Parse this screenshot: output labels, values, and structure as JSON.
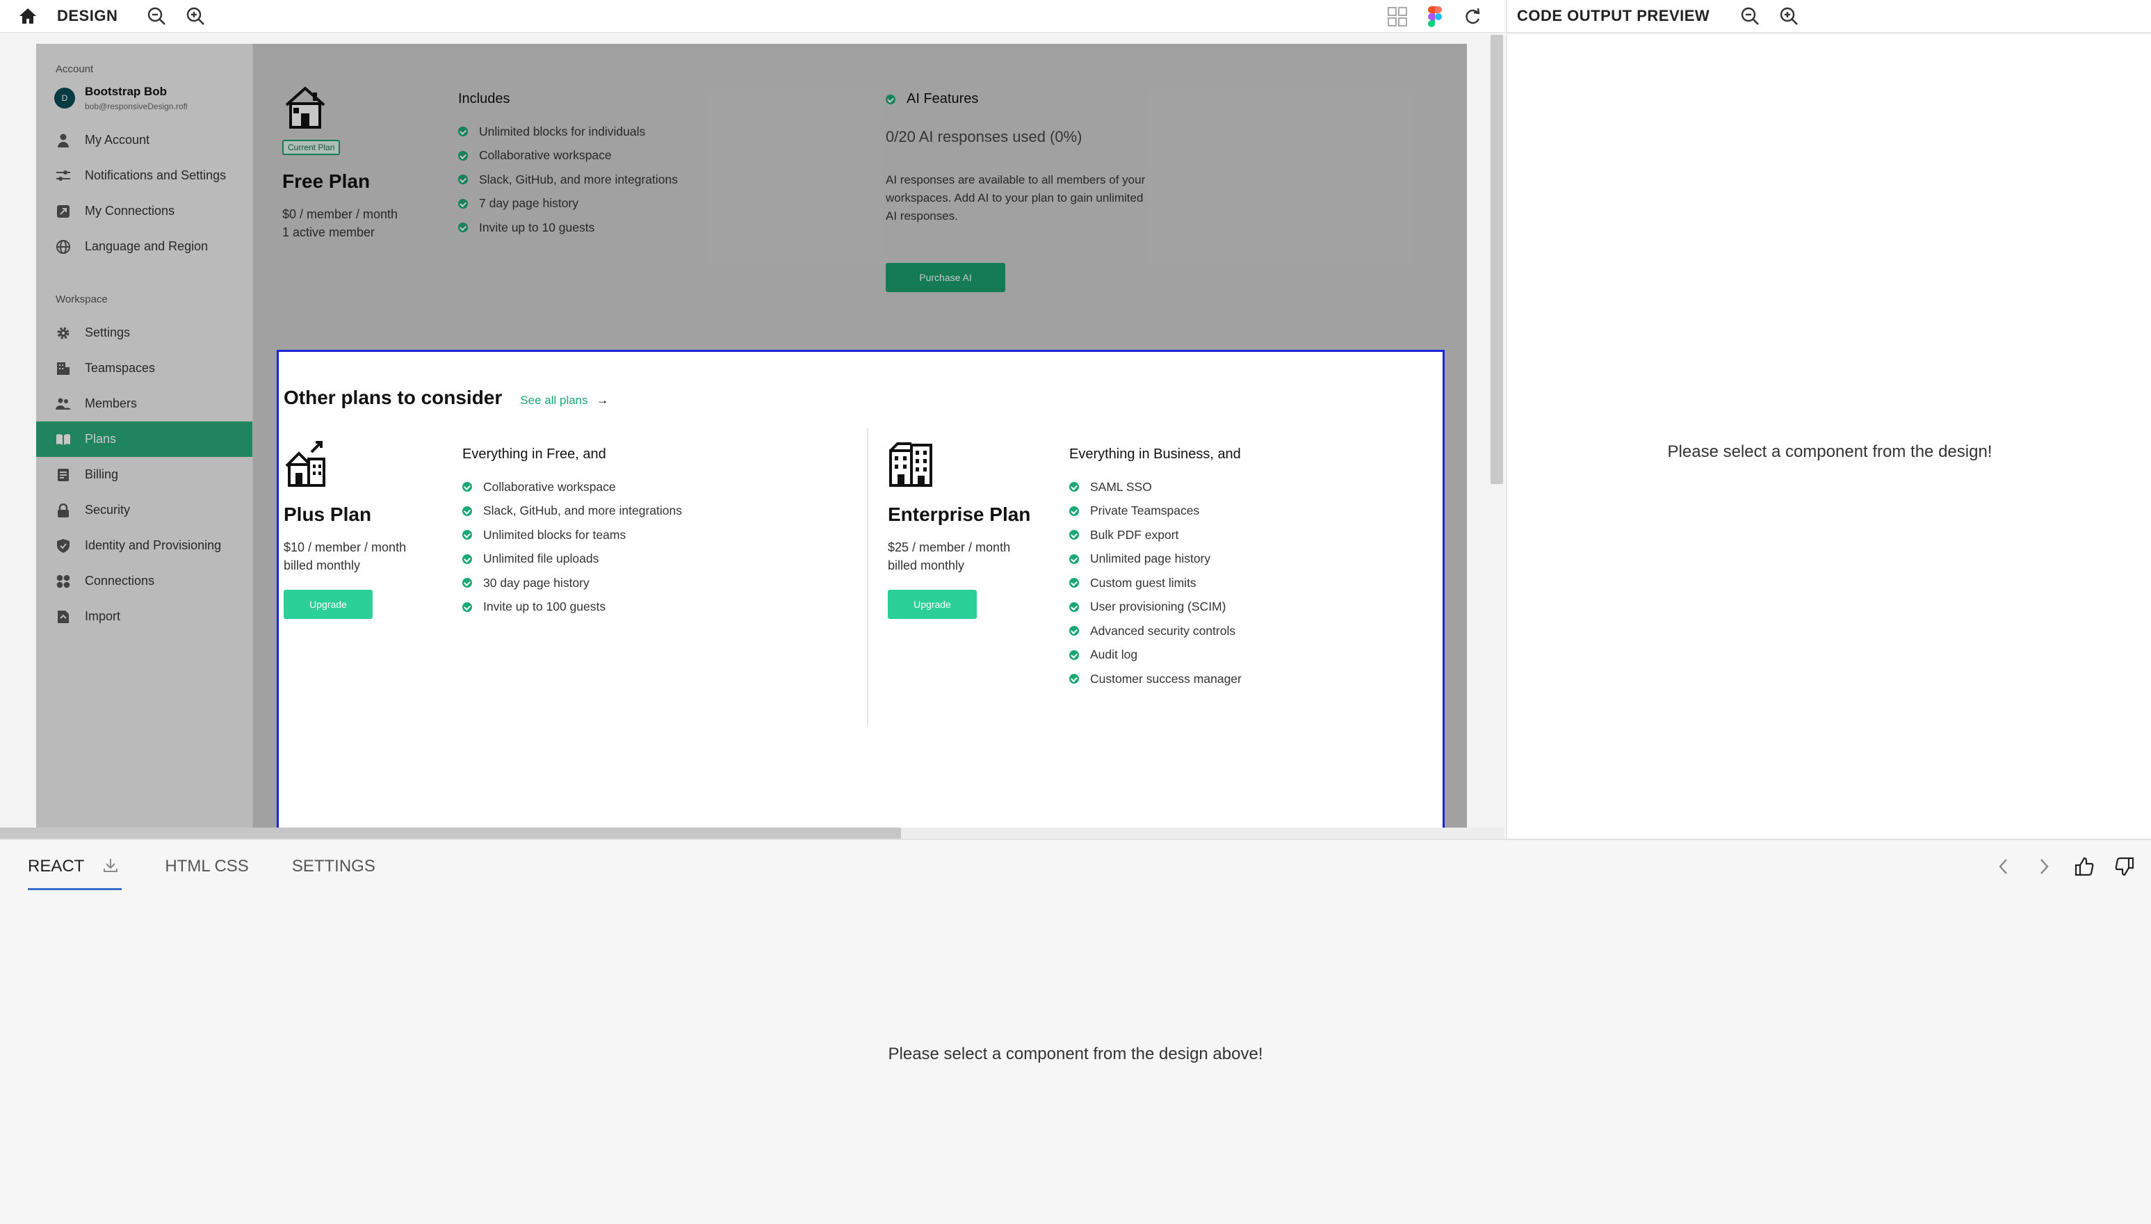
{
  "design_bar": {
    "title": "DESIGN"
  },
  "preview_bar": {
    "title": "CODE OUTPUT PREVIEW"
  },
  "sidebar": {
    "account_section": "Account",
    "user": {
      "avatar": "D",
      "name": "Bootstrap Bob",
      "email": "bob@responsiveDesign.rofl"
    },
    "account_items": [
      {
        "label": "My Account",
        "icon": "person-icon"
      },
      {
        "label": "Notifications and Settings",
        "icon": "sliders-icon"
      },
      {
        "label": "My Connections",
        "icon": "link-box-icon"
      },
      {
        "label": "Language and Region",
        "icon": "globe-icon"
      }
    ],
    "workspace_section": "Workspace",
    "workspace_items": [
      {
        "label": "Settings",
        "icon": "gear-icon"
      },
      {
        "label": "Teamspaces",
        "icon": "building-icon"
      },
      {
        "label": "Members",
        "icon": "people-icon"
      },
      {
        "label": "Plans",
        "icon": "book-icon",
        "active": true
      },
      {
        "label": "Billing",
        "icon": "receipt-icon"
      },
      {
        "label": "Security",
        "icon": "lock-icon"
      },
      {
        "label": "Identity and Provisioning",
        "icon": "shield-icon"
      },
      {
        "label": "Connections",
        "icon": "grid-icon"
      },
      {
        "label": "Import",
        "icon": "file-icon"
      }
    ]
  },
  "current_plan": {
    "badge": "Current Plan",
    "name": "Free Plan",
    "price": "$0 / member / month",
    "members": "1 active member",
    "includes_title": "Includes",
    "features": [
      "Unlimited blocks for individuals",
      "Collaborative workspace",
      "Slack, GitHub, and more integrations",
      "7 day page history",
      "Invite up to 10 guests"
    ]
  },
  "ai": {
    "title": "AI Features",
    "used": "0/20 AI responses used (0%)",
    "description": "AI responses are available to all members of your workspaces. Add AI to your plan to gain unlimited AI responses.",
    "button": "Purchase AI"
  },
  "other_plans": {
    "title": "Other plans to consider",
    "link": "See all plans",
    "plus": {
      "name": "Plus Plan",
      "price": "$10 / member / month",
      "billing": "billed monthly",
      "button": "Upgrade",
      "features_title": "Everything in Free, and",
      "features": [
        "Collaborative workspace",
        "Slack, GitHub, and more integrations",
        "Unlimited blocks for teams",
        "Unlimited file uploads",
        "30 day page history",
        "Invite up to 100 guests"
      ]
    },
    "enterprise": {
      "name": "Enterprise Plan",
      "price": "$25 / member / month",
      "billing": "billed monthly",
      "button": "Upgrade",
      "features_title": "Everything in Business, and",
      "features": [
        "SAML SSO",
        "Private Teamspaces",
        "Bulk PDF export",
        "Unlimited page history",
        "Custom guest limits",
        "User provisioning (SCIM)",
        "Advanced security controls",
        "Audit log",
        "Customer success manager"
      ]
    }
  },
  "preview_message": "Please select a component from the design!",
  "bottom": {
    "tabs": [
      "REACT",
      "HTML CSS",
      "SETTINGS"
    ],
    "message": "Please select a component from the design above!"
  },
  "colors": {
    "accent": "#1aa874",
    "upgrade": "#2bcf98",
    "selection": "#1d23d6",
    "tab_underline": "#3a6fc7"
  }
}
